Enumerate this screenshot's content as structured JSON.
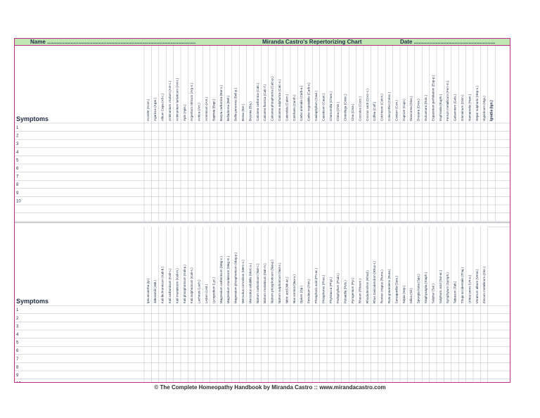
{
  "header": {
    "name_label": "Name ...............................................................................................",
    "title": "Miranda Castro's Repertorizing Chart",
    "date_label": "Date ...................................................."
  },
  "symptoms_label": "Symptoms",
  "row_numbers": [
    "1",
    "2",
    "3",
    "4",
    "5",
    "6",
    "7",
    "8",
    "9",
    "10"
  ],
  "remedies_top": [
    "Aconite (Acon.)",
    "Agaricus (Agar.)",
    "Allium Cepa (All-c.)",
    "Antimonium crudum (Ant-c.)",
    "Antimonium tartaricum (Ant-t.)",
    "Apis (Apis.)",
    "Argentum nitricum (Arg-n.)",
    "Arnica (Arn.)",
    "Arsenicum (Ars.)",
    "Baptisia (Bapt.)",
    "Baryta carbonica (Bar-c.)",
    "Belladonna (Bell.)",
    "Bellis perennis (Bell-p.)",
    "Borax (Bor.)",
    "Bryonia (Bry.)",
    "Calcarea carbonica (Calc.)",
    "Calcarea fluorica (Calc-f.)",
    "Calcarea phosphorica (Calc-p.)",
    "Calcarea sulphurica (Calc-s.)",
    "Calendula (Calen.)",
    "Cantharis (Canth.)",
    "Carbo animalis (Carb-a.)",
    "Carbo vegetabilis (Carb-v.)",
    "Caulophyllum (Caul.)",
    "Causticum (Caust.)",
    "Chamomilla (Cham.)",
    "China (Chin.)",
    "Cimicifuga (Cimic.)",
    "Cina (Cina.)",
    "Cocculus (Cocc.)",
    "Coccus cacti (Cocc-c.)",
    "Coffea (Coff.)",
    "Colchicum (Colch.)",
    "Colocynthis (Coloc.)",
    "Conium (Con.)",
    "Cuprum (Cupr.)",
    "Dioscorea (Dios.)",
    "Drosera (Dros.)",
    "Dulcamara (Dulc.)",
    "Eupatorium perfoliatum (Eup-p.)",
    "Euphrasia (Euphr.)",
    "Ferrum metallicum (Ferr-m.)",
    "Gelsemium (Gels.)",
    "Glonoinum (Glon.)",
    "Hamamelis (Ham.)",
    "Hepar sulphuris (Hep-s.)",
    "Hypericum (Hyp.)",
    "Ignatia (Ign.)"
  ],
  "remedies_bottom": [
    "Ipecacuanha (Ip.)",
    "Jaborandi (Jab.)",
    "Kali bichromicum (Kali-b.)",
    "Kali carbonicum (Kali-c.)",
    "Kali muriaticum (Kali-m.)",
    "Kali phosphoricum (Kali-p.)",
    "Kali sulphuricum (Kali-s.)",
    "Lachesis (Lach.)",
    "Ledum (Led.)",
    "Lycopodium (Lyc.)",
    "Magnesium carbonicum (Mag-c.)",
    "Magnesium muriaticum (Mag-m.)",
    "Magnesium phosphoricum (Mag-p.)",
    "Mercurius corrosivus (Merc-c.)",
    "Mercurius solubilis (Merc-s.)",
    "Natrum carbonicum (Nat-c.)",
    "Natrum muriaticum (Nat-m.)",
    "Natrum phosphoricum (Nat-p.)",
    "Natrum sulphuricum (Nat-s.)",
    "Nitric acid (Nit-ac.)",
    "Nux vomica (Nux-v.)",
    "Opium (Op.)",
    "Petroleum (Petr.)",
    "Phosphoric acid (Ph-ac.)",
    "Phosphorus (Phos.)",
    "Phytolacca (Phyt.)",
    "Podophyllum (Podo.)",
    "Pulsatilla (Puls.)",
    "Pyrogenium (Pyr.)",
    "Rheum (Rheum.)",
    "Rhododendron (Rhod.)",
    "Rhus toxicodendron (Rhus-t.)",
    "Rumex crispus (Rumx.)",
    "Ruta graveolens (Ruta.)",
    "Sarsaparilla (Sars.)",
    "Sepia (Sep.)",
    "Silica (Sil.)",
    "Spongia tosta (Spo.)",
    "Staphysagria (Staph.)",
    "Sulphur (Sul.)",
    "Sulphuric acid (Sul-ac.)",
    "Symphytum (Symph.)",
    "Tabacum (Tab.)",
    "Thuja occidentalis (Thuj.)",
    "Urtica urens (Urt-u.)",
    "Veratrum album (Verat.)",
    "Zincum metallicum (Zinc.)"
  ],
  "footer": "© The Complete Homeopathy Handbook by Miranda Castro :: www.mirandacastro.com",
  "colors": {
    "border": "#c0308a",
    "header_bg": "#bfe6b3",
    "text": "#1f2a44",
    "grid": "#b9b9c2"
  }
}
